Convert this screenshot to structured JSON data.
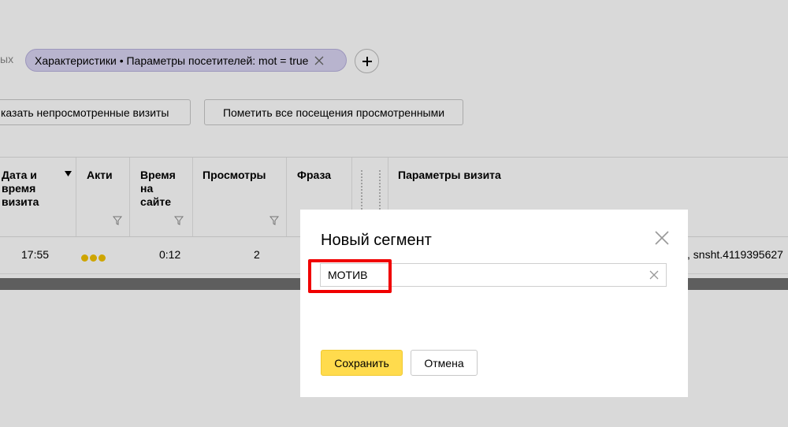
{
  "filters": {
    "label_fragment": "ых",
    "chip_text": "Характеристики • Параметры посетителей: mot = true",
    "add_icon": "plus-icon",
    "chip_close_icon": "close-icon"
  },
  "toolbar": {
    "show_unviewed": "казать непросмотренные визиты",
    "mark_all_viewed": "Пометить все посещения просмотренными"
  },
  "table": {
    "columns": [
      {
        "label": "Дата и время визита",
        "lines": [
          "Дата и",
          "время",
          "визита"
        ],
        "sortable": true
      },
      {
        "label": "Активность",
        "lines": [
          "Акти"
        ]
      },
      {
        "label": "Время на сайте",
        "lines": [
          "Время",
          "на",
          "сайте"
        ]
      },
      {
        "label": "Просмотры",
        "lines": [
          "Просмотры"
        ]
      },
      {
        "label": "Фраза",
        "lines": [
          "Фраза"
        ]
      },
      {
        "label": "Параметры визита",
        "lines": [
          "Параметры визита"
        ]
      }
    ],
    "sort_icon": "sort-desc-icon",
    "filter_icon": "funnel-icon",
    "rows": [
      {
        "time": "17:55",
        "activity_level": 3,
        "duration": "0:12",
        "views": "2",
        "params": ", snsht.4119395627"
      }
    ]
  },
  "dialog": {
    "title": "Новый сегмент",
    "close_icon": "close-icon",
    "name_value": "МОТИВ",
    "clear_icon": "clear-icon",
    "save_label": "Сохранить",
    "cancel_label": "Отмена"
  },
  "colors": {
    "accent_yellow": "#ffdb4d",
    "chip_bg": "#d9d4f2",
    "highlight_red": "#f00000",
    "activity_dot": "#f2c200"
  }
}
